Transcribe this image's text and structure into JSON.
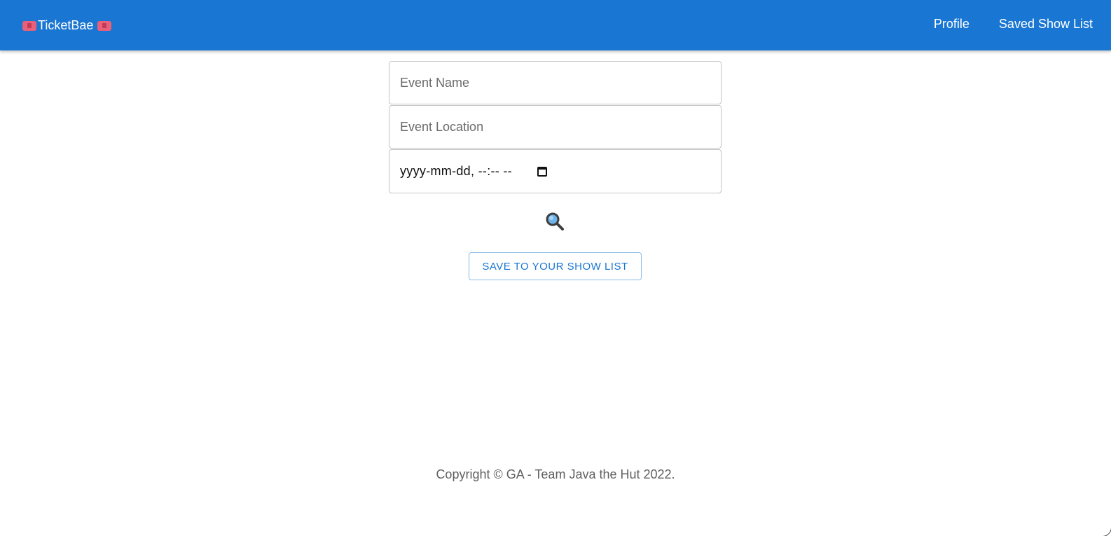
{
  "header": {
    "brand": "TicketBae",
    "brand_icons": [
      "ticket-icon",
      "ticket-icon"
    ],
    "nav": {
      "profile": "Profile",
      "saved_show_list": "Saved Show List"
    },
    "color": "#1976d2"
  },
  "form": {
    "event_name_placeholder": "Event Name",
    "event_location_placeholder": "Event Location",
    "datetime_placeholder": "yyyy-mm-dd, --:-- --",
    "search_icon": "magnifying-glass-icon",
    "save_button": "SAVE TO YOUR SHOW LIST"
  },
  "footer": {
    "copyright": "Copyright © GA - Team Java the Hut 2022."
  }
}
